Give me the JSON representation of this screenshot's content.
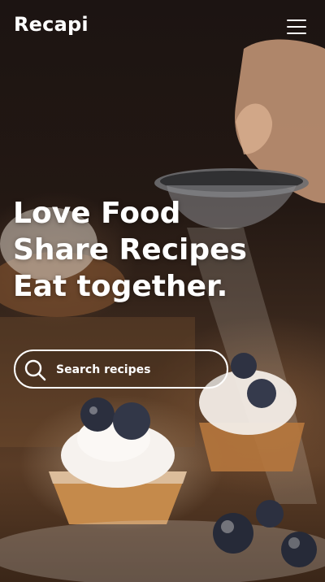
{
  "header": {
    "logo": "Recapi",
    "menu_icon": "hamburger-menu-icon"
  },
  "hero": {
    "lines": [
      "Love Food",
      "Share Recipes",
      "Eat together."
    ]
  },
  "search": {
    "placeholder": "Search recipes",
    "icon": "search-icon"
  },
  "colors": {
    "text": "#ffffff",
    "background": "#1c1412"
  }
}
